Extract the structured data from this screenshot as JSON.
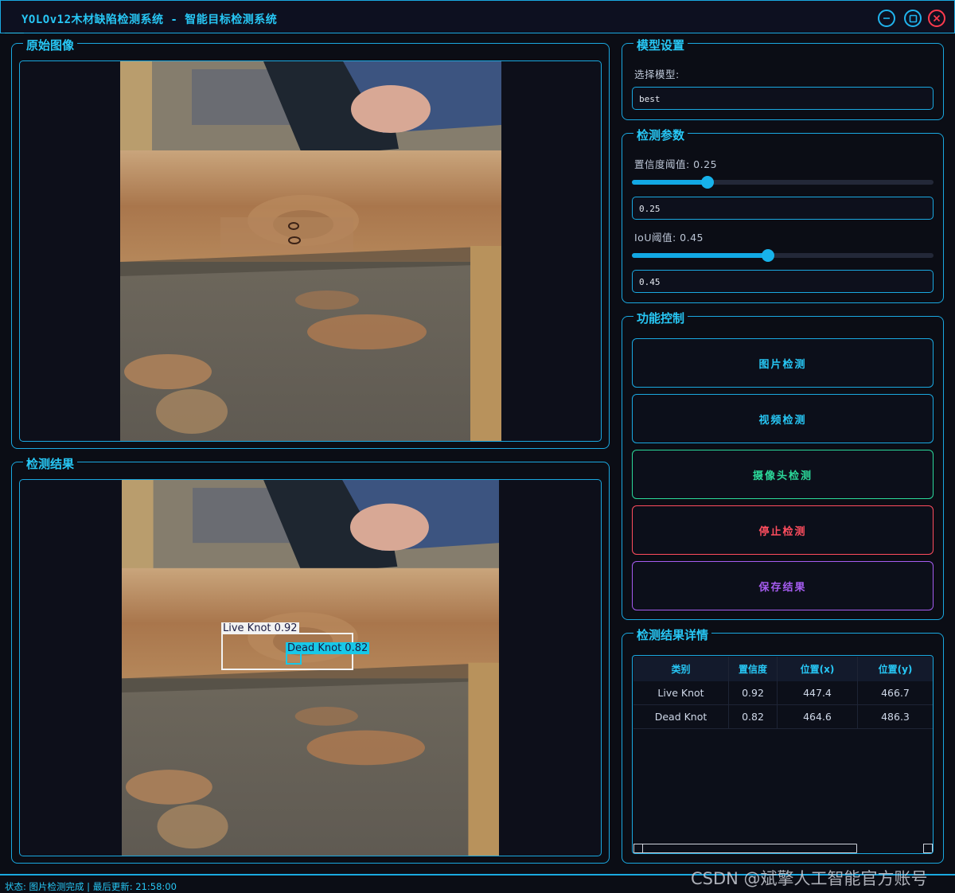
{
  "window": {
    "title": "YOLOv12木材缺陷检测系统 - 智能目标检测系统",
    "minimize_icon": "minimize-icon",
    "maximize_icon": "maximize-icon",
    "close_icon": "close-icon"
  },
  "original_panel": {
    "title": "原始图像"
  },
  "result_panel": {
    "title": "检测结果",
    "detections": [
      {
        "label": "Live Knot 0.92"
      },
      {
        "label": "Dead Knot 0.82"
      }
    ]
  },
  "model_settings": {
    "title": "模型设置",
    "select_label": "选择模型:",
    "selected_model": "best"
  },
  "detection_params": {
    "title": "检测参数",
    "confidence_label": "置信度阈值: 0.25",
    "confidence_value": "0.25",
    "confidence_level": 0.25,
    "iou_label": "IoU阈值: 0.45",
    "iou_value": "0.45",
    "iou_level": 0.45
  },
  "controls": {
    "title": "功能控制",
    "image_detect": "图片检测",
    "video_detect": "视频检测",
    "camera_detect": "摄像头检测",
    "stop_detect": "停止检测",
    "save_results": "保存结果"
  },
  "results_table": {
    "title": "检测结果详情",
    "columns": [
      "类别",
      "置信度",
      "位置(x)",
      "位置(y)"
    ],
    "rows": [
      [
        "Live Knot",
        "0.92",
        "447.4",
        "466.7"
      ],
      [
        "Dead Knot",
        "0.82",
        "464.6",
        "486.3"
      ]
    ]
  },
  "status": {
    "text": "状态: 图片检测完成 | 最后更新: 21:58:00"
  },
  "watermark": "CSDN @斌擎人工智能官方账号",
  "colors": {
    "accent": "#27c7f5",
    "camera": "#2bd99a",
    "stop": "#ff4d5e",
    "save": "#a55cf0"
  }
}
